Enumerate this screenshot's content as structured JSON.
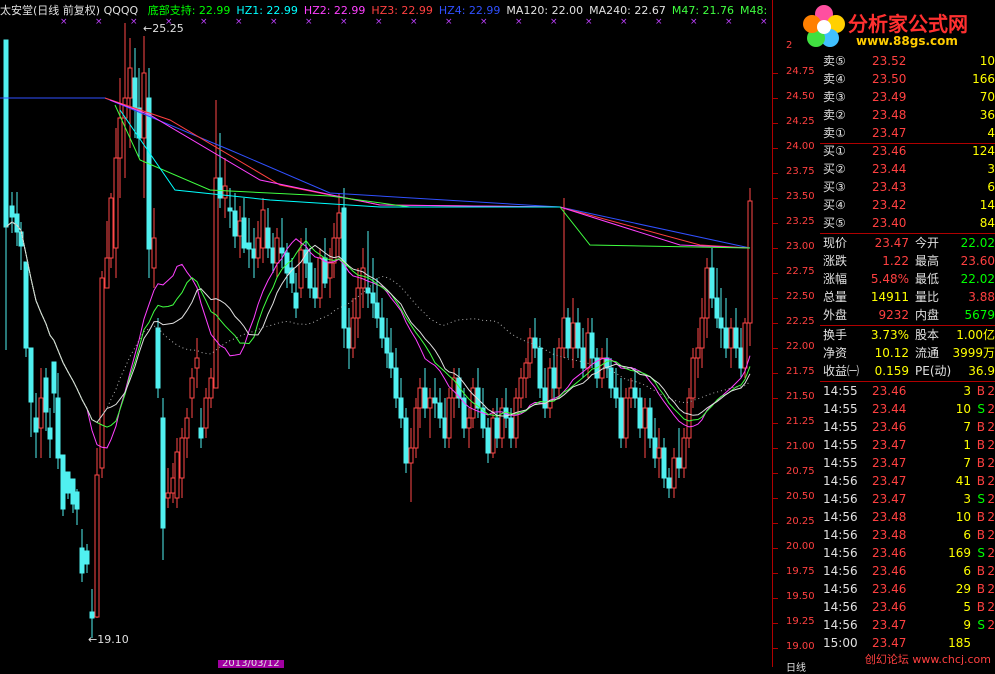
{
  "header": {
    "title": "太安堂(日线 前复权) QQQQ",
    "indicators": [
      {
        "label": "底部支持: 22.99",
        "color": "#00ff00"
      },
      {
        "label": "HZ1: 22.99",
        "color": "#00ffff"
      },
      {
        "label": "HZ2: 22.99",
        "color": "#ff40ff"
      },
      {
        "label": "HZ3: 22.99",
        "color": "#ff4040"
      },
      {
        "label": "HZ4: 22.99",
        "color": "#3050ff"
      },
      {
        "label": "MA120: 22.00",
        "color": "#e0e0e0"
      },
      {
        "label": "MA240: 22.67",
        "color": "#e0e0e0"
      },
      {
        "label": "M47: 21.76",
        "color": "#40ff40"
      },
      {
        "label": "M48:",
        "color": "#40ff40"
      }
    ]
  },
  "annotations": {
    "high": "25.25",
    "low": "19.10",
    "date": "2013/03/12"
  },
  "y_axis": {
    "ticks": [
      "24.75",
      "24.50",
      "24.25",
      "24.00",
      "23.75",
      "23.50",
      "23.25",
      "23.00",
      "22.75",
      "22.50",
      "22.25",
      "22.00",
      "21.75",
      "21.50",
      "21.25",
      "21.00",
      "20.75",
      "20.50",
      "20.25",
      "20.00",
      "19.75",
      "19.50",
      "19.25",
      "19.00"
    ],
    "top": "2",
    "bottom": "日线"
  },
  "logo": {
    "name": "分析家公式网",
    "url": "www.88gs.com"
  },
  "order_book": [
    {
      "label": "卖⑤",
      "price": "23.52",
      "vol": "10"
    },
    {
      "label": "卖④",
      "price": "23.50",
      "vol": "166"
    },
    {
      "label": "卖③",
      "price": "23.49",
      "vol": "70"
    },
    {
      "label": "卖②",
      "price": "23.48",
      "vol": "36"
    },
    {
      "label": "卖①",
      "price": "23.47",
      "vol": "4"
    },
    {
      "label": "买①",
      "price": "23.46",
      "vol": "124"
    },
    {
      "label": "买②",
      "price": "23.44",
      "vol": "3"
    },
    {
      "label": "买③",
      "price": "23.43",
      "vol": "6"
    },
    {
      "label": "买④",
      "price": "23.42",
      "vol": "14"
    },
    {
      "label": "买⑤",
      "price": "23.40",
      "vol": "84"
    }
  ],
  "quote": [
    {
      "l1": "现价",
      "v1": "23.47",
      "l2": "今开",
      "v2": "22.02",
      "c1": "#ff4040",
      "c2": "#00ff00"
    },
    {
      "l1": "涨跌",
      "v1": "1.22",
      "l2": "最高",
      "v2": "23.60",
      "c1": "#ff4040",
      "c2": "#ff4040"
    },
    {
      "l1": "涨幅",
      "v1": "5.48%",
      "l2": "最低",
      "v2": "22.02",
      "c1": "#ff4040",
      "c2": "#00ff00"
    },
    {
      "l1": "总量",
      "v1": "14911",
      "l2": "量比",
      "v2": "3.88",
      "c1": "#ffff00",
      "c2": "#ff4040"
    },
    {
      "l1": "外盘",
      "v1": "9232",
      "l2": "内盘",
      "v2": "5679",
      "c1": "#ff4040",
      "c2": "#00ff00"
    }
  ],
  "fundamentals": [
    {
      "l1": "换手",
      "v1": "3.73%",
      "l2": "股本",
      "v2": "1.00亿",
      "c1": "#ffff00",
      "c2": "#ffff00"
    },
    {
      "l1": "净资",
      "v1": "10.12",
      "l2": "流通",
      "v2": "3999万",
      "c1": "#ffff00",
      "c2": "#ffff00"
    },
    {
      "l1": "收益㈠",
      "v1": "0.159",
      "l2": "PE(动)",
      "v2": "36.9",
      "c1": "#ffff00",
      "c2": "#ffff00"
    }
  ],
  "ticks": [
    {
      "t": "14:55",
      "p": "23.46",
      "q": "3",
      "s": "B",
      "x": "2"
    },
    {
      "t": "14:55",
      "p": "23.44",
      "q": "10",
      "s": "S",
      "x": "2"
    },
    {
      "t": "14:55",
      "p": "23.46",
      "q": "7",
      "s": "B",
      "x": "2"
    },
    {
      "t": "14:55",
      "p": "23.47",
      "q": "1",
      "s": "B",
      "x": "2"
    },
    {
      "t": "14:55",
      "p": "23.47",
      "q": "7",
      "s": "B",
      "x": "2"
    },
    {
      "t": "14:56",
      "p": "23.47",
      "q": "41",
      "s": "B",
      "x": "2"
    },
    {
      "t": "14:56",
      "p": "23.47",
      "q": "3",
      "s": "S",
      "x": "2"
    },
    {
      "t": "14:56",
      "p": "23.48",
      "q": "10",
      "s": "B",
      "x": "2"
    },
    {
      "t": "14:56",
      "p": "23.48",
      "q": "6",
      "s": "B",
      "x": "2"
    },
    {
      "t": "14:56",
      "p": "23.46",
      "q": "169",
      "s": "S",
      "x": "2"
    },
    {
      "t": "14:56",
      "p": "23.46",
      "q": "6",
      "s": "B",
      "x": "2"
    },
    {
      "t": "14:56",
      "p": "23.46",
      "q": "29",
      "s": "B",
      "x": "2"
    },
    {
      "t": "14:56",
      "p": "23.46",
      "q": "5",
      "s": "B",
      "x": "2"
    },
    {
      "t": "14:56",
      "p": "23.47",
      "q": "9",
      "s": "S",
      "x": "2"
    },
    {
      "t": "15:00",
      "p": "23.47",
      "q": "185",
      "s": "",
      "x": ""
    }
  ],
  "watermark": "创幻论坛 www.chcj.com",
  "candles": [
    [
      6,
      25.08,
      25.08,
      21.98,
      23.21
    ],
    [
      12,
      23.42,
      23.56,
      23.15,
      23.31
    ],
    [
      17,
      23.34,
      23.56,
      23.02,
      23.16
    ],
    [
      21,
      23.16,
      23.26,
      22.78,
      23.02
    ],
    [
      26,
      22.86,
      22.86,
      21.91,
      22.0
    ],
    [
      31,
      22.0,
      22.0,
      21.11,
      21.46
    ],
    [
      36,
      21.3,
      21.55,
      20.9,
      21.16
    ],
    [
      41,
      21.2,
      21.8,
      20.9,
      21.5
    ],
    [
      46,
      21.7,
      21.8,
      21.17,
      21.36
    ],
    [
      50,
      21.2,
      21.4,
      20.9,
      21.09
    ],
    [
      54,
      21.86,
      21.86,
      21.35,
      21.55
    ],
    [
      58,
      21.5,
      21.75,
      20.79,
      20.9
    ],
    [
      63,
      20.93,
      20.93,
      20.32,
      20.39
    ],
    [
      68,
      20.76,
      20.76,
      20.49,
      20.55
    ],
    [
      73,
      20.69,
      20.69,
      20.35,
      20.44
    ],
    [
      77,
      20.56,
      20.59,
      20.23,
      20.39
    ],
    [
      82,
      20.0,
      20.19,
      19.66,
      19.75
    ],
    [
      87,
      19.97,
      20.04,
      19.75,
      19.84
    ],
    [
      92,
      19.36,
      19.59,
      19.1,
      19.3
    ],
    [
      97,
      19.31,
      21.0,
      19.3,
      20.73
    ],
    [
      102,
      20.8,
      22.77,
      20.7,
      22.7
    ],
    [
      107,
      22.6,
      23.27,
      22.6,
      22.9
    ],
    [
      111,
      22.9,
      23.55,
      22.8,
      23.5
    ],
    [
      116,
      23.0,
      24.2,
      22.7,
      23.9
    ],
    [
      120,
      23.9,
      24.7,
      23.5,
      24.3
    ],
    [
      125,
      24.3,
      25.25,
      23.7,
      24.5
    ],
    [
      130,
      24.5,
      25.1,
      24.0,
      24.8
    ],
    [
      135,
      24.7,
      25.0,
      24.1,
      24.4
    ],
    [
      139,
      24.4,
      24.8,
      23.9,
      24.1
    ],
    [
      144,
      24.1,
      25.12,
      23.5,
      24.75
    ],
    [
      149,
      24.5,
      24.8,
      22.7,
      22.99
    ],
    [
      154,
      22.8,
      23.4,
      22.6,
      23.1
    ],
    [
      158,
      22.2,
      22.3,
      21.5,
      21.6
    ],
    [
      163,
      21.3,
      21.5,
      19.88,
      20.2
    ],
    [
      168,
      20.5,
      20.8,
      20.4,
      20.55
    ],
    [
      173,
      20.55,
      20.85,
      20.45,
      20.7
    ],
    [
      177,
      20.5,
      21.1,
      20.4,
      20.96
    ],
    [
      182,
      20.7,
      21.2,
      20.5,
      21.1
    ],
    [
      187,
      21.1,
      21.4,
      20.9,
      21.3
    ],
    [
      192,
      21.5,
      21.8,
      21.3,
      21.7
    ],
    [
      197,
      21.8,
      22.1,
      21.6,
      21.9
    ],
    [
      201,
      21.2,
      21.4,
      21.0,
      21.1
    ],
    [
      206,
      21.2,
      21.6,
      21.1,
      21.5
    ],
    [
      211,
      21.5,
      21.8,
      21.4,
      21.7
    ],
    [
      216,
      21.6,
      24.48,
      21.6,
      23.7
    ],
    [
      220,
      23.7,
      24.15,
      23.4,
      23.5
    ],
    [
      225,
      23.5,
      23.9,
      23.3,
      23.62
    ],
    [
      230,
      23.4,
      23.6,
      23.2,
      23.37
    ],
    [
      235,
      23.37,
      23.55,
      23.0,
      23.12
    ],
    [
      240,
      23.12,
      23.42,
      22.9,
      23.27
    ],
    [
      244,
      23.3,
      23.5,
      22.95,
      23.0
    ],
    [
      249,
      23.05,
      23.3,
      22.8,
      22.99
    ],
    [
      254,
      22.99,
      23.2,
      22.7,
      22.9
    ],
    [
      258,
      22.9,
      23.27,
      22.8,
      23.1
    ],
    [
      263,
      23.0,
      23.5,
      22.85,
      23.38
    ],
    [
      268,
      23.2,
      23.4,
      22.9,
      23.0
    ],
    [
      273,
      23.0,
      23.15,
      22.75,
      22.85
    ],
    [
      277,
      22.85,
      23.2,
      22.7,
      23.1
    ],
    [
      282,
      23.0,
      23.3,
      22.8,
      22.95
    ],
    [
      287,
      22.95,
      23.05,
      22.6,
      22.75
    ],
    [
      292,
      22.8,
      22.9,
      22.55,
      22.65
    ],
    [
      296,
      22.55,
      22.75,
      22.3,
      22.4
    ],
    [
      301,
      22.6,
      23.1,
      22.5,
      22.98
    ],
    [
      306,
      22.98,
      23.2,
      22.7,
      22.85
    ],
    [
      310,
      22.85,
      23.0,
      22.5,
      22.6
    ],
    [
      315,
      22.6,
      22.8,
      22.4,
      22.5
    ],
    [
      320,
      22.5,
      23.0,
      22.4,
      22.9
    ],
    [
      325,
      22.9,
      23.1,
      22.6,
      22.65
    ],
    [
      330,
      22.7,
      23.0,
      22.5,
      22.85
    ],
    [
      334,
      22.85,
      23.25,
      22.7,
      23.1
    ],
    [
      339,
      23.1,
      23.55,
      22.9,
      23.35
    ],
    [
      344,
      23.4,
      23.6,
      22.0,
      22.2
    ],
    [
      349,
      22.2,
      22.4,
      21.79,
      22.0
    ],
    [
      353,
      22.0,
      22.5,
      21.9,
      22.3
    ],
    [
      358,
      22.3,
      22.8,
      22.1,
      22.6
    ],
    [
      363,
      22.6,
      23.0,
      22.4,
      22.8
    ],
    [
      368,
      22.6,
      23.17,
      22.4,
      22.55
    ],
    [
      373,
      22.55,
      22.9,
      22.3,
      22.45
    ],
    [
      377,
      22.45,
      22.7,
      22.2,
      22.3
    ],
    [
      382,
      22.3,
      22.5,
      22.0,
      22.1
    ],
    [
      387,
      22.1,
      22.3,
      21.8,
      21.95
    ],
    [
      391,
      21.95,
      22.2,
      21.7,
      21.8
    ],
    [
      396,
      21.8,
      22.0,
      21.4,
      21.5
    ],
    [
      401,
      21.5,
      21.7,
      21.2,
      21.3
    ],
    [
      406,
      21.3,
      21.4,
      20.75,
      20.85
    ],
    [
      411,
      20.85,
      21.2,
      20.46,
      21.0
    ],
    [
      416,
      21.0,
      21.5,
      20.9,
      21.4
    ],
    [
      420,
      21.4,
      21.7,
      21.2,
      21.6
    ],
    [
      425,
      21.6,
      21.8,
      21.3,
      21.4
    ],
    [
      430,
      21.4,
      21.6,
      21.1,
      21.5
    ],
    [
      435,
      21.5,
      21.7,
      21.3,
      21.45
    ],
    [
      440,
      21.45,
      21.6,
      21.2,
      21.3
    ],
    [
      445,
      21.3,
      21.5,
      21.0,
      21.1
    ],
    [
      449,
      21.1,
      21.6,
      21.0,
      21.5
    ],
    [
      454,
      21.5,
      21.8,
      21.3,
      21.7
    ],
    [
      459,
      21.7,
      21.8,
      21.4,
      21.5
    ],
    [
      464,
      21.5,
      21.6,
      21.1,
      21.2
    ],
    [
      469,
      21.2,
      21.4,
      21.0,
      21.3
    ],
    [
      473,
      21.3,
      21.7,
      21.2,
      21.6
    ],
    [
      478,
      21.6,
      21.8,
      21.3,
      21.4
    ],
    [
      483,
      21.4,
      21.6,
      21.1,
      21.2
    ],
    [
      488,
      21.2,
      21.3,
      20.85,
      20.95
    ],
    [
      493,
      20.95,
      21.4,
      20.9,
      21.3
    ],
    [
      497,
      21.3,
      21.5,
      21.0,
      21.1
    ],
    [
      502,
      21.1,
      21.5,
      21.0,
      21.4
    ],
    [
      506,
      21.4,
      21.6,
      21.2,
      21.3
    ],
    [
      511,
      21.3,
      21.4,
      21.0,
      21.1
    ],
    [
      516,
      21.1,
      21.6,
      21.0,
      21.5
    ],
    [
      521,
      21.5,
      21.8,
      21.4,
      21.7
    ],
    [
      526,
      21.7,
      21.9,
      21.5,
      21.85
    ],
    [
      530,
      21.85,
      22.2,
      21.7,
      22.1
    ],
    [
      535,
      22.1,
      22.3,
      21.9,
      22.0
    ],
    [
      540,
      22.0,
      22.1,
      21.5,
      21.6
    ],
    [
      545,
      21.6,
      21.8,
      21.3,
      21.4
    ],
    [
      550,
      21.4,
      21.9,
      21.3,
      21.8
    ],
    [
      554,
      21.8,
      22.0,
      21.5,
      21.6
    ],
    [
      559,
      21.6,
      22.1,
      21.5,
      22.0
    ],
    [
      564,
      22.0,
      23.5,
      21.9,
      22.3
    ],
    [
      568,
      22.3,
      22.4,
      21.9,
      22.0
    ],
    [
      573,
      22.0,
      22.5,
      21.8,
      22.25
    ],
    [
      578,
      22.25,
      22.4,
      21.9,
      22.0
    ],
    [
      583,
      22.0,
      22.2,
      21.7,
      21.8
    ],
    [
      588,
      21.8,
      22.3,
      21.7,
      22.15
    ],
    [
      592,
      22.15,
      22.3,
      21.8,
      21.9
    ],
    [
      597,
      21.9,
      22.0,
      21.6,
      21.7
    ],
    [
      602,
      21.7,
      22.0,
      21.6,
      21.9
    ],
    [
      607,
      21.9,
      22.1,
      21.7,
      21.8
    ],
    [
      611,
      21.8,
      21.9,
      21.5,
      21.6
    ],
    [
      616,
      21.6,
      21.8,
      21.4,
      21.5
    ],
    [
      621,
      21.5,
      21.7,
      21.0,
      21.1
    ],
    [
      626,
      21.1,
      21.6,
      21.0,
      21.5
    ],
    [
      631,
      21.5,
      21.7,
      21.4,
      21.6
    ],
    [
      635,
      21.6,
      21.8,
      21.4,
      21.5
    ],
    [
      640,
      21.5,
      21.6,
      21.1,
      21.2
    ],
    [
      645,
      21.2,
      21.5,
      20.9,
      21.4
    ],
    [
      650,
      21.4,
      21.5,
      21.0,
      21.1
    ],
    [
      655,
      21.1,
      21.3,
      20.8,
      20.9
    ],
    [
      659,
      20.9,
      21.2,
      20.7,
      21.0
    ],
    [
      664,
      21.0,
      21.1,
      20.6,
      20.7
    ],
    [
      669,
      20.7,
      20.8,
      20.5,
      20.6
    ],
    [
      674,
      20.6,
      21.0,
      20.5,
      20.9
    ],
    [
      679,
      20.9,
      21.2,
      20.7,
      20.8
    ],
    [
      684,
      20.8,
      21.2,
      20.7,
      21.1
    ],
    [
      689,
      21.1,
      21.6,
      21.0,
      21.5
    ],
    [
      693,
      21.5,
      22.0,
      21.4,
      21.9
    ],
    [
      698,
      21.9,
      22.2,
      21.7,
      22.0
    ],
    [
      702,
      22.0,
      22.5,
      21.8,
      22.3
    ],
    [
      707,
      22.3,
      22.9,
      22.1,
      22.8
    ],
    [
      712,
      22.8,
      23.0,
      22.4,
      22.5
    ],
    [
      717,
      22.5,
      22.8,
      22.2,
      22.3
    ],
    [
      721,
      22.3,
      22.6,
      22.0,
      22.2
    ],
    [
      726,
      22.2,
      22.5,
      21.9,
      22.0
    ],
    [
      731,
      22.0,
      22.3,
      21.8,
      22.2
    ],
    [
      736,
      22.2,
      22.4,
      21.9,
      22.0
    ],
    [
      741,
      22.0,
      22.2,
      21.7,
      21.8
    ],
    [
      745,
      21.8,
      22.3,
      21.7,
      22.25
    ],
    [
      750,
      22.25,
      23.6,
      22.02,
      23.47
    ]
  ]
}
